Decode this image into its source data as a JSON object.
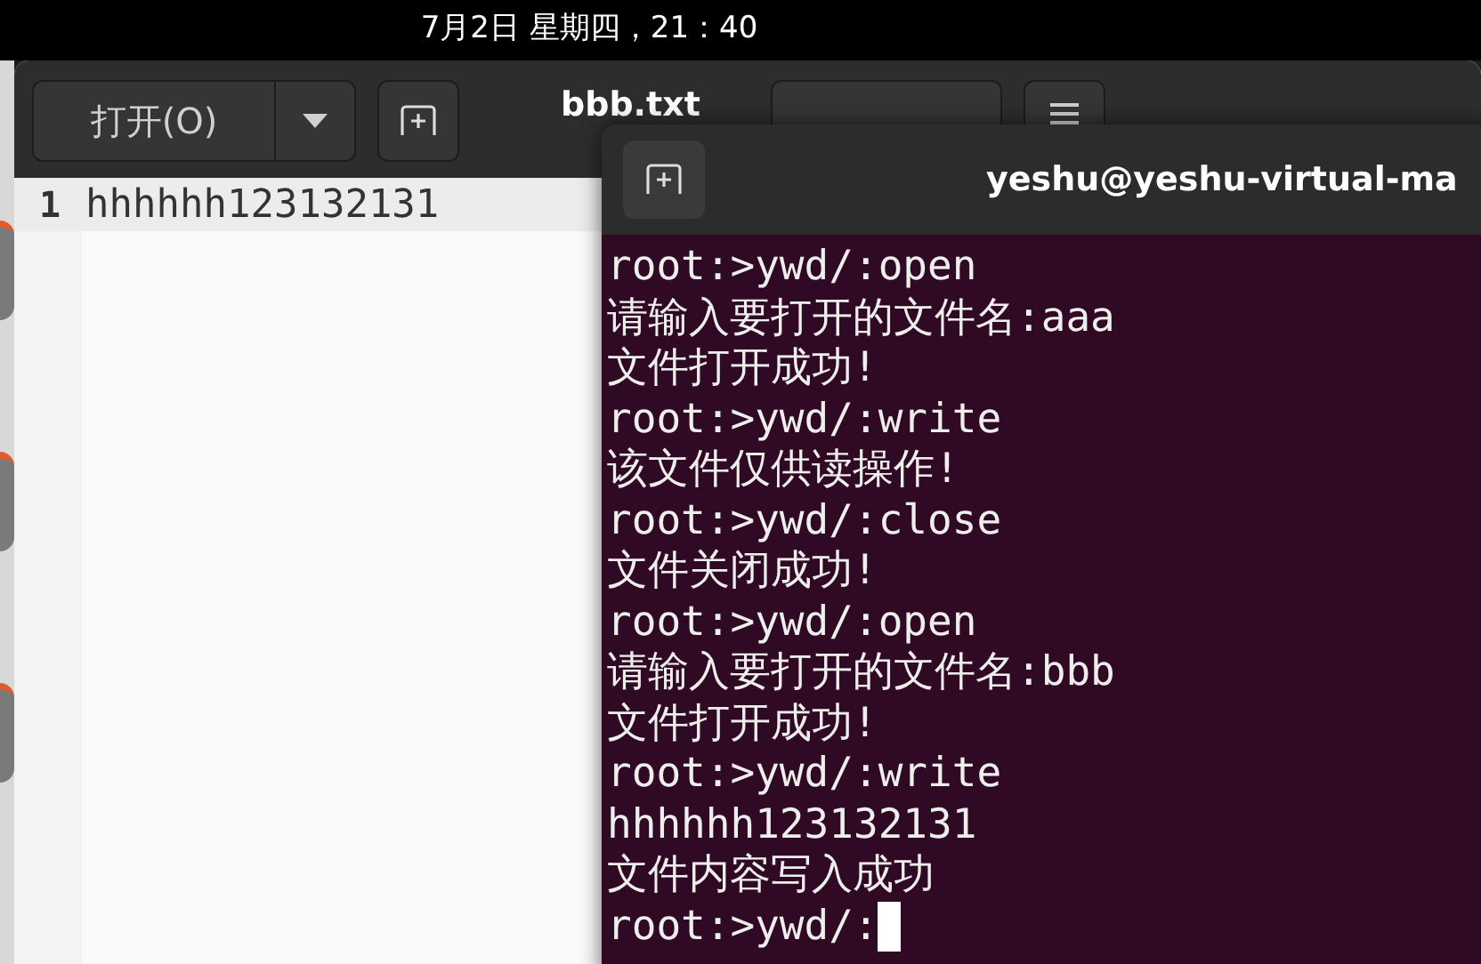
{
  "top_bar": {
    "clock": "7月2日 星期四，21：40"
  },
  "editor": {
    "title": "bbb.txt",
    "open_button": "打开(O)",
    "lines": [
      {
        "number": "1",
        "text": "hhhhhh123132131"
      }
    ]
  },
  "terminal": {
    "title": "yeshu@yeshu-virtual-ma",
    "lines": [
      "root:>ywd/:open",
      "请输入要打开的文件名:aaa",
      "文件打开成功!",
      "root:>ywd/:write",
      "该文件仅供读操作!",
      "root:>ywd/:close",
      "文件关闭成功!",
      "root:>ywd/:open",
      "请输入要打开的文件名:bbb",
      "文件打开成功!",
      "root:>ywd/:write",
      "hhhhhh123132131",
      "文件内容写入成功"
    ],
    "prompt": "root:>ywd/:"
  }
}
